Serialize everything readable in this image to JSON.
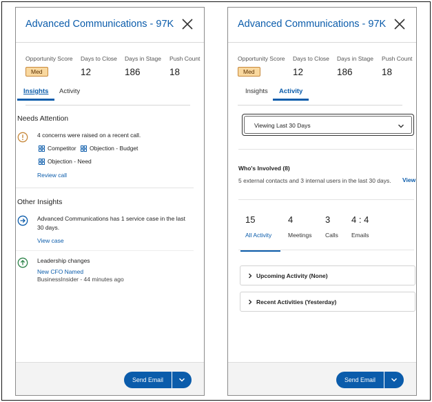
{
  "left": {
    "title": "Advanced Communications - 97K",
    "stats": [
      {
        "label": "Opportunity Score",
        "value": "Med"
      },
      {
        "label": "Days to Close",
        "value": "12"
      },
      {
        "label": "Days in Stage",
        "value": "186"
      },
      {
        "label": "Push Count",
        "value": "18"
      }
    ],
    "tabs": [
      "Insights",
      "Activity"
    ],
    "needs_attention": {
      "title": "Needs Attention",
      "text": "4 concerns were raised on a recent call.",
      "chips": [
        "Competitor",
        "Objection - Budget",
        "Objection - Need"
      ],
      "link": "Review call"
    },
    "other_insights": {
      "title": "Other Insights",
      "service_text_1": "Advanced Communications has 1 service case in the last",
      "service_text_2": "30 days.",
      "service_link": "View case",
      "leadership_title": "Leadership changes",
      "leadership_link": "New CFO Named",
      "leadership_source": "BusinessInsider - 44 minutes ago"
    },
    "footer": {
      "button": "Send Email"
    }
  },
  "right": {
    "title": "Advanced Communications - 97K",
    "stats": [
      {
        "label": "Opportunity Score",
        "value": "Med"
      },
      {
        "label": "Days to Close",
        "value": "12"
      },
      {
        "label": "Days in Stage",
        "value": "186"
      },
      {
        "label": "Push Count",
        "value": "18"
      }
    ],
    "tabs": [
      "Insights",
      "Activity"
    ],
    "filter": "Viewing Last 30 Days",
    "involved": {
      "title": "Who's Involved (8)",
      "text": "5 external contacts and 3 internal users in the last 30 days.",
      "link": "View"
    },
    "counts": [
      {
        "n": "15",
        "label": "All Activity"
      },
      {
        "n": "4",
        "label": "Meetings"
      },
      {
        "n": "3",
        "label": "Calls"
      },
      {
        "n": "4 : 4",
        "label": "Emails"
      }
    ],
    "accordions": [
      "Upcoming Activity (None)",
      "Recent Activities (Yesterday)"
    ],
    "footer": {
      "button": "Send Email"
    }
  },
  "colors": {
    "brand": "#0b5cab",
    "warning": "#c7883b",
    "badge_bg": "#f9d89f",
    "success": "#2e844a"
  }
}
